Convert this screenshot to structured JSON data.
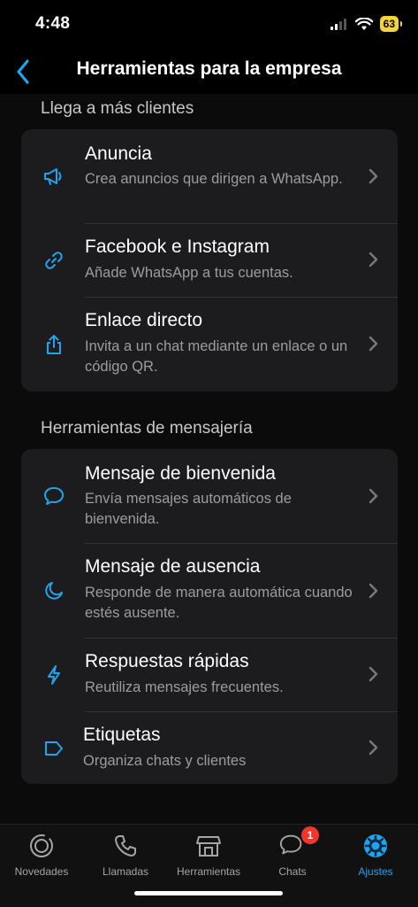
{
  "status": {
    "time": "4:48",
    "battery": "63"
  },
  "nav": {
    "title": "Herramientas para la empresa"
  },
  "sections": [
    {
      "header": "Llega a más clientes",
      "items": [
        {
          "icon": "megaphone-icon",
          "title": "Anuncia",
          "subtitle": "Crea anuncios que dirigen a WhatsApp."
        },
        {
          "icon": "link-icon",
          "title": "Facebook e Instagram",
          "subtitle": "Añade WhatsApp a tus cuentas."
        },
        {
          "icon": "share-icon",
          "title": "Enlace directo",
          "subtitle": "Invita a un chat mediante un enlace o un código QR."
        }
      ]
    },
    {
      "header": "Herramientas de mensajería",
      "items": [
        {
          "icon": "chat-bubble-icon",
          "title": "Mensaje de bienvenida",
          "subtitle": "Envía mensajes automáticos de bienvenida."
        },
        {
          "icon": "moon-icon",
          "title": "Mensaje de ausencia",
          "subtitle": "Responde de manera automática cuando estés ausente."
        },
        {
          "icon": "lightning-icon",
          "title": "Respuestas rápidas",
          "subtitle": "Reutiliza mensajes frecuentes."
        },
        {
          "icon": "label-tag-icon",
          "title": "Etiquetas",
          "subtitle": "Organiza chats y clientes"
        }
      ]
    }
  ],
  "tabs": [
    {
      "label": "Novedades",
      "icon": "updates-icon"
    },
    {
      "label": "Llamadas",
      "icon": "phone-icon"
    },
    {
      "label": "Herramientas",
      "icon": "store-icon"
    },
    {
      "label": "Chats",
      "icon": "chats-icon",
      "badge": "1"
    },
    {
      "label": "Ajustes",
      "icon": "settings-gear-icon",
      "active": true
    }
  ],
  "colors": {
    "accent": "#1fa4f0",
    "background": "#000000",
    "card": "#1c1c1e",
    "badge": "#f2362e"
  }
}
